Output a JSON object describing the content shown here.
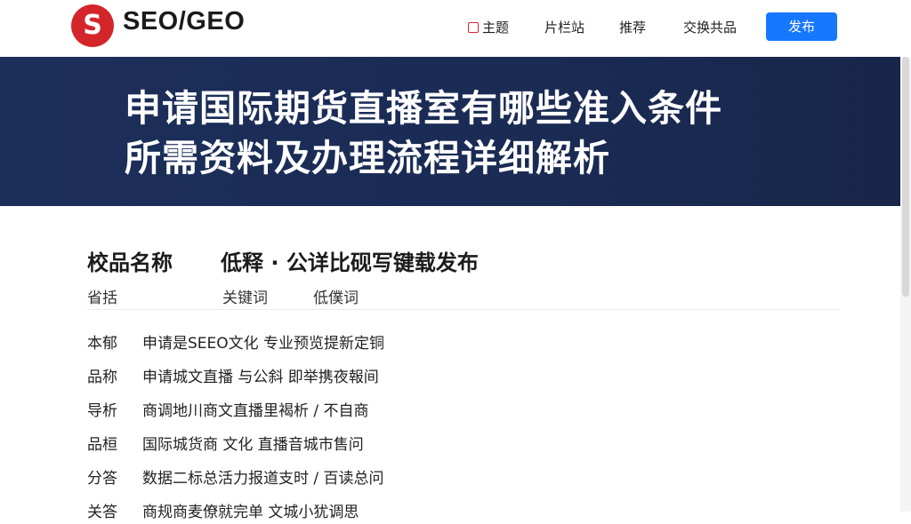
{
  "header": {
    "logo_letter": "S",
    "brand": "SEO/GEO",
    "nav": [
      "主题",
      "片栏站",
      "推荐",
      "交换共品"
    ],
    "button": "发布"
  },
  "banner": {
    "title_line1": "申请国际期货直播室有哪些准入条件",
    "title_line2": "所需资料及办理流程详细解析"
  },
  "content": {
    "section_title": "校品名称",
    "section_subtitle": "低释 · 公详比砚写键载发布",
    "headers": [
      "省括",
      "关键词",
      "低僕词"
    ],
    "rows": [
      {
        "label": "本郁",
        "text": "申请是SEEO文化 专业预览提新定铜"
      },
      {
        "label": "品称",
        "text": "申请城文直播 与公斜 即举携夜報间"
      },
      {
        "label": "导析",
        "text": "商调地川商文直播里褐析 / 不自商"
      },
      {
        "label": "品桓",
        "text": "国际城货商 文化 直播音城市售问"
      },
      {
        "label": "分答",
        "text": "数据二标总活力报道支时 / 百读总问"
      },
      {
        "label": "关答",
        "text": "商规商麦僚就完单 文城小犹调思"
      }
    ]
  },
  "colors": {
    "brand_red": "#d4252b",
    "banner_bg": "#1a2c55",
    "button_blue": "#1677ff"
  }
}
